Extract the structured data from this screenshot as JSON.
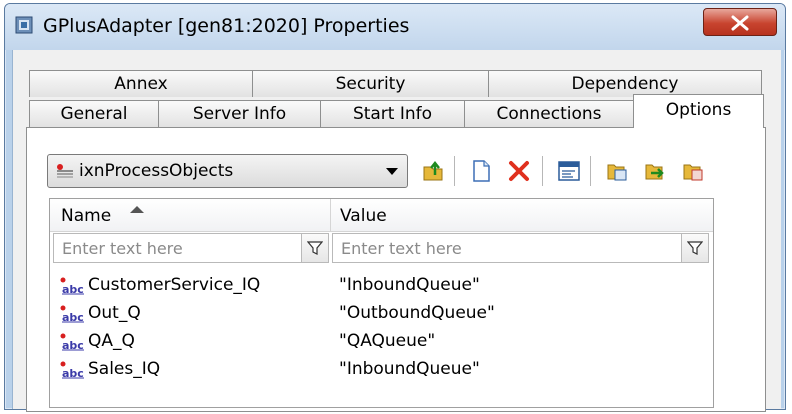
{
  "window": {
    "title": "GPlusAdapter [gen81:2020] Properties"
  },
  "tabs": {
    "row_back": [
      "Annex",
      "Security",
      "Dependency"
    ],
    "row_front": [
      "General",
      "Server Info",
      "Start Info",
      "Connections",
      "Options"
    ],
    "active": "Options"
  },
  "section_selector": {
    "selected": "ixnProcessObjects",
    "icon": "section-icon"
  },
  "toolbar": {
    "icons": [
      "folder-up-icon",
      "new-item-icon",
      "delete-icon",
      "edit-icon",
      "copy-icon",
      "import-icon",
      "export-icon"
    ]
  },
  "grid": {
    "columns": [
      "Name",
      "Value"
    ],
    "filter_placeholder": "Enter text here",
    "rows": [
      {
        "name": "CustomerService_IQ",
        "value": "\"InboundQueue\""
      },
      {
        "name": "Out_Q",
        "value": "\"OutboundQueue\""
      },
      {
        "name": "QA_Q",
        "value": "\"QAQueue\""
      },
      {
        "name": "Sales_IQ",
        "value": "\"InboundQueue\""
      }
    ]
  },
  "colors": {
    "titlebar": "#c2d6ec",
    "close_button": "#c8442f",
    "delete_red": "#e0301e"
  }
}
